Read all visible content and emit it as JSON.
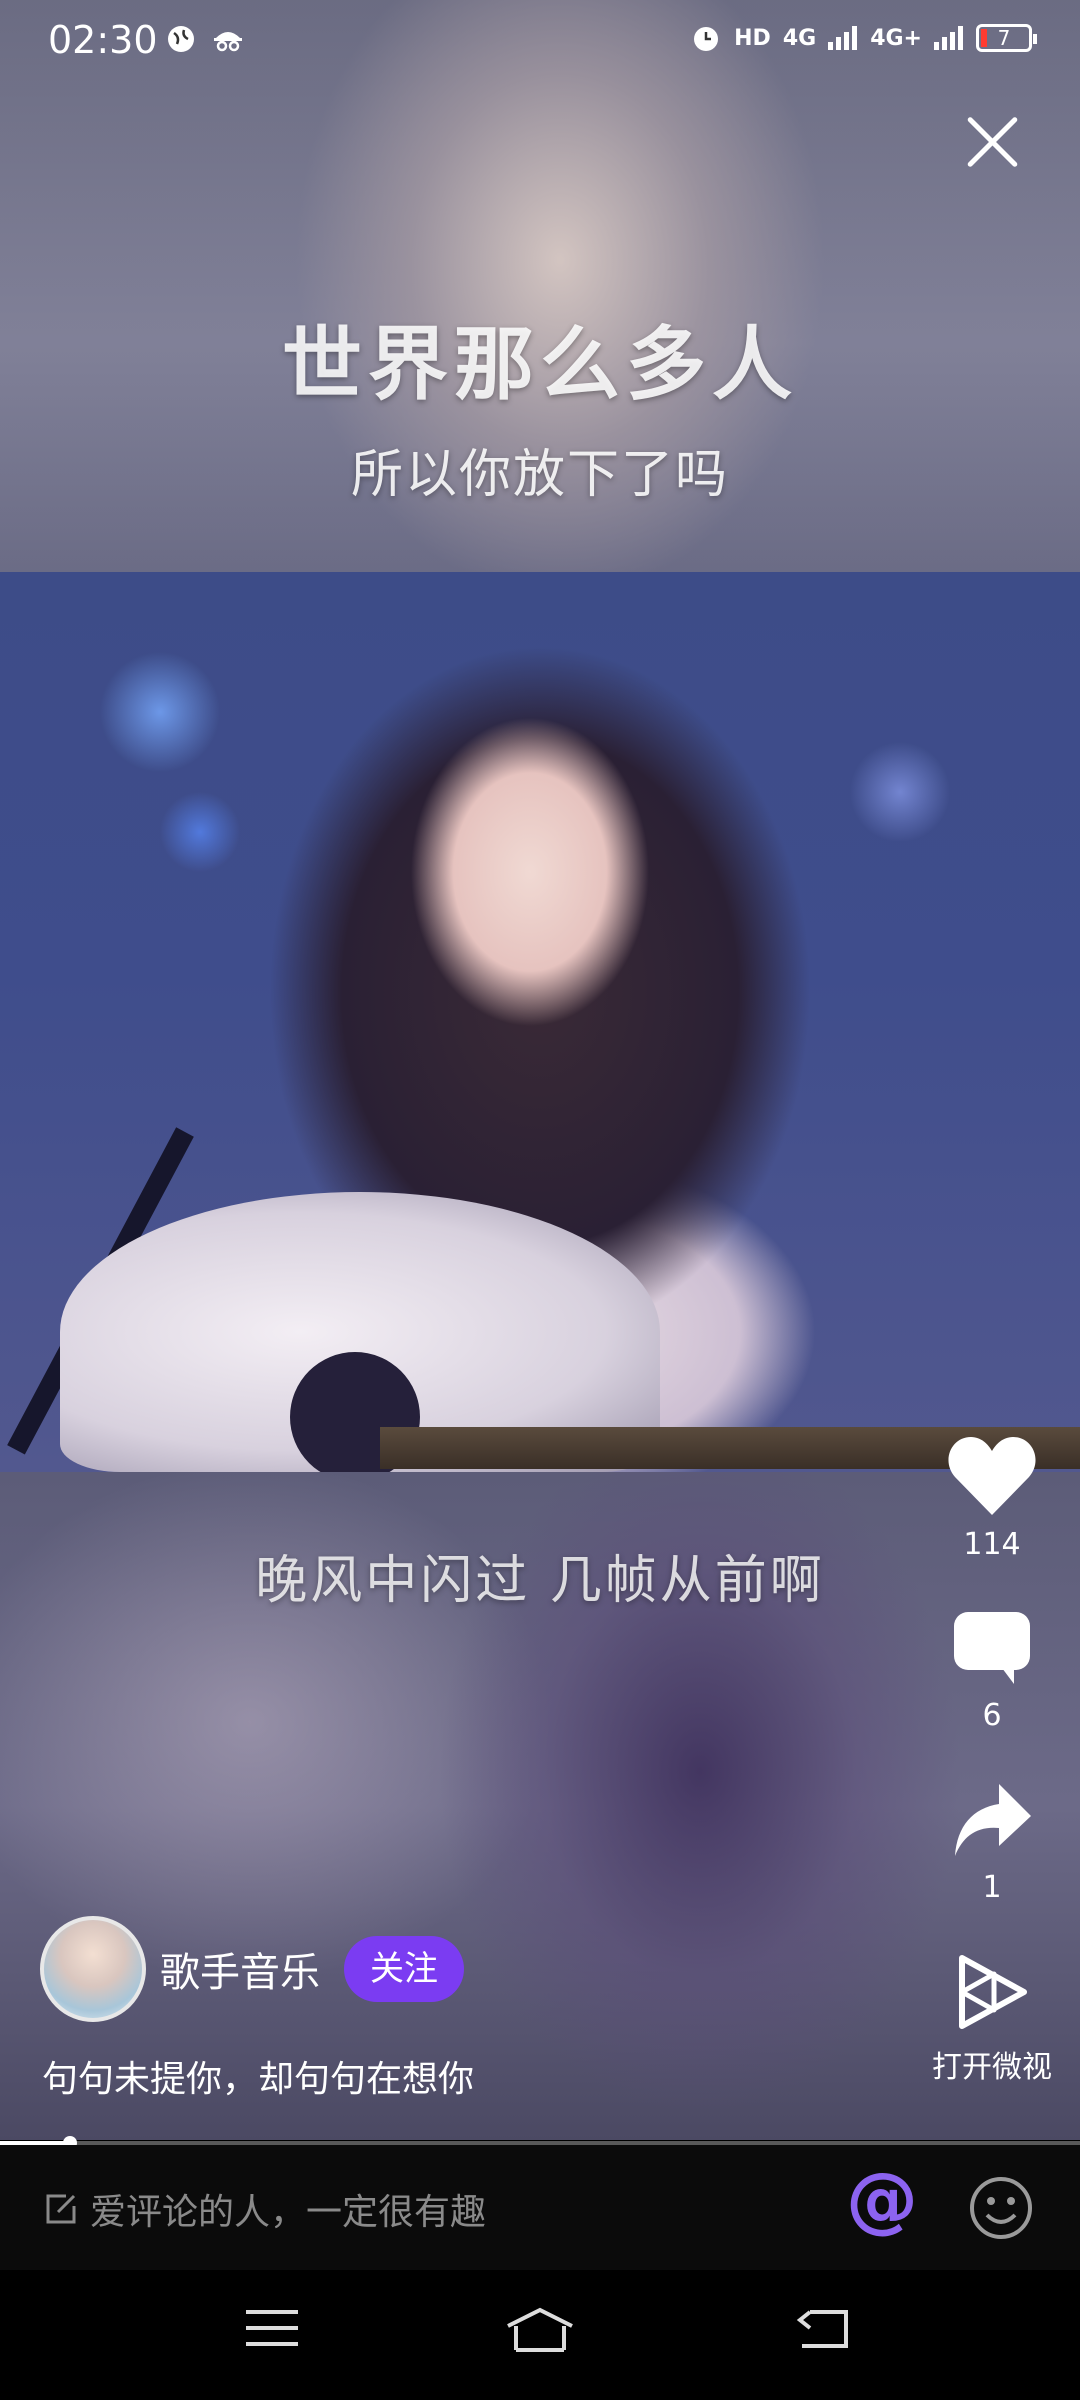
{
  "status_bar": {
    "time": "02:30",
    "right_icons": [
      "alarm-icon",
      "HD",
      "4G",
      "4G+"
    ],
    "battery": "7"
  },
  "video": {
    "caption_top_1": "世界那么多人",
    "caption_top_2": "所以你放下了吗",
    "caption_bottom": "晚风中闪过 几帧从前啊"
  },
  "actions": {
    "like_count": "114",
    "comment_count": "6",
    "share_count": "1",
    "open_label": "打开微视"
  },
  "author": {
    "name": "歌手音乐",
    "follow_label": "关注",
    "description": "句句未提你，却句句在想你"
  },
  "progress": {
    "played_fraction": 0.065
  },
  "comment_bar": {
    "placeholder": "爱评论的人，一定很有趣",
    "at_symbol": "@"
  },
  "colors": {
    "accent": "#7b3cf2",
    "at_icon": "#8c63f0"
  }
}
